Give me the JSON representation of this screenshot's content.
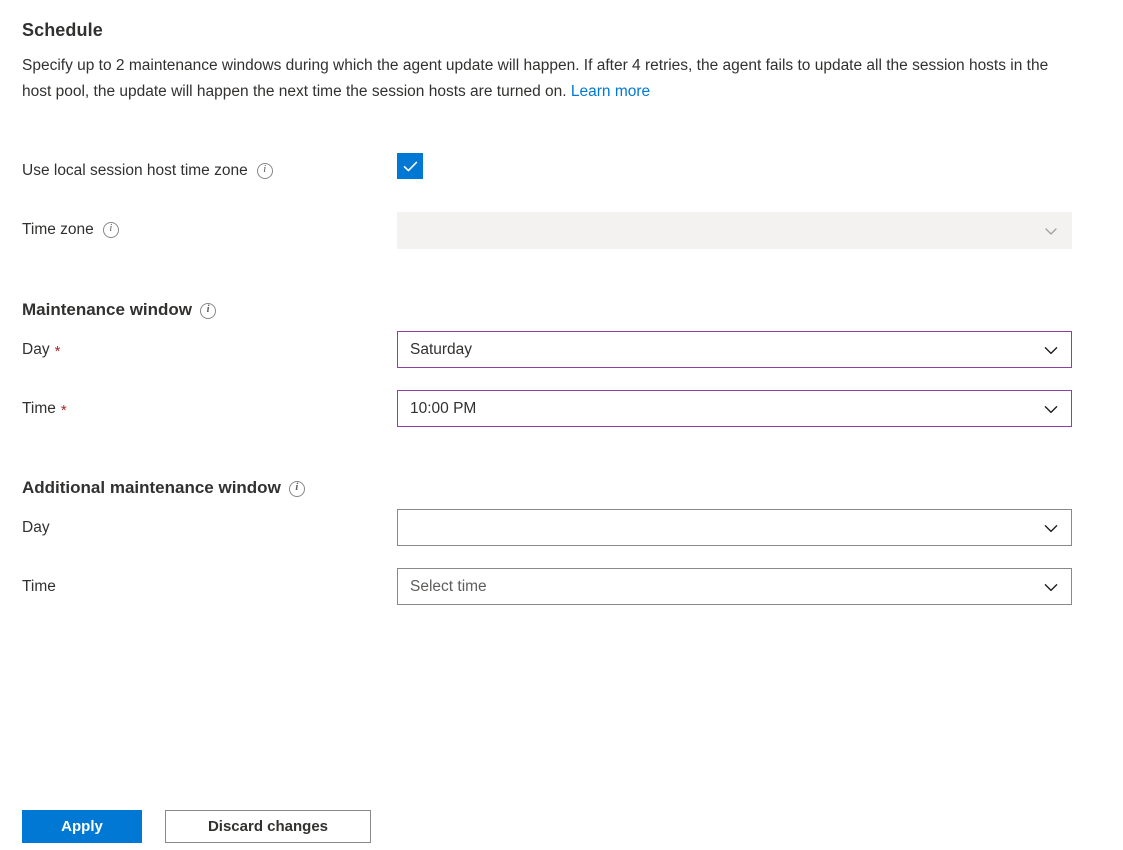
{
  "section": {
    "title": "Schedule",
    "description_part1": "Specify up to 2 maintenance windows during which the agent update will happen. If after 4 retries, the agent fails to update all the session hosts in the host pool, the update will happen the next time the session hosts are turned on. ",
    "learn_more_label": "Learn more"
  },
  "local_timezone": {
    "label": "Use local session host time zone",
    "checked": true,
    "info_glyph": "i"
  },
  "timezone": {
    "label": "Time zone",
    "value": "",
    "placeholder": "",
    "disabled": true,
    "info_glyph": "i"
  },
  "maintenance_window": {
    "heading": "Maintenance window",
    "info_glyph": "i",
    "day": {
      "label": "Day",
      "required_marker": "*",
      "value": "Saturday",
      "placeholder": ""
    },
    "time": {
      "label": "Time",
      "required_marker": "*",
      "value": "10:00 PM",
      "placeholder": ""
    }
  },
  "additional_maintenance_window": {
    "heading": "Additional maintenance window",
    "info_glyph": "i",
    "day": {
      "label": "Day",
      "value": "",
      "placeholder": ""
    },
    "time": {
      "label": "Time",
      "value": "",
      "placeholder": "Select time"
    }
  },
  "actions": {
    "apply_label": "Apply",
    "discard_label": "Discard changes"
  },
  "colors": {
    "accent": "#0078d4",
    "modified_border": "#8f3f9e",
    "required_star": "#a4262c",
    "disabled_bg": "#f3f2f1",
    "border": "#8a8886",
    "text": "#323130"
  }
}
